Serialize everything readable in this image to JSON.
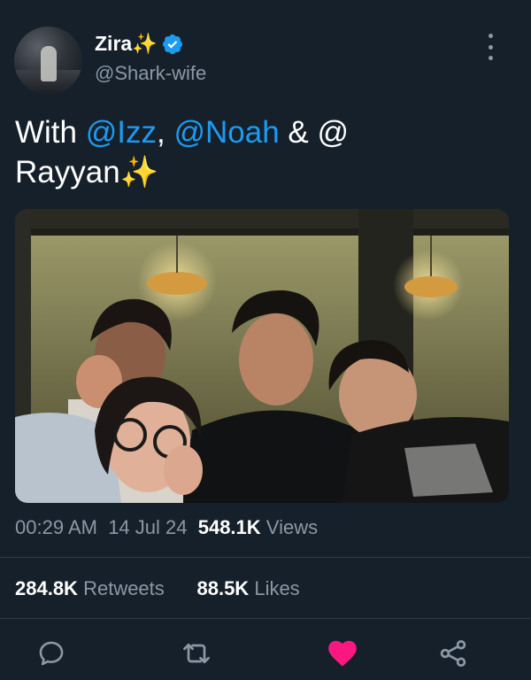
{
  "author": {
    "display_name": "Zira",
    "name_emoji": "✨",
    "handle": "@Shark-wife",
    "verified": true
  },
  "tweet": {
    "text_with": "With ",
    "mention_1": "@Izz",
    "sep_1": ", ",
    "mention_2": "@Noah",
    "sep_2": " & @",
    "line_2": "Rayyan",
    "end_emoji": "✨"
  },
  "meta": {
    "time": "00:29 AM",
    "date": "14 Jul 24",
    "views_count": "548.1K",
    "views_label": "Views"
  },
  "stats": {
    "retweets_count": "284.8K",
    "retweets_label": "Retweets",
    "likes_count": "88.5K",
    "likes_label": "Likes"
  },
  "actions": {
    "reply_icon": "reply-icon",
    "retweet_icon": "retweet-icon",
    "like_icon": "heart-filled-icon",
    "share_icon": "share-icon",
    "liked_color": "#f91880",
    "icon_color": "#8b98a5"
  },
  "colors": {
    "background": "#15202b",
    "accent": "#1d9bf0",
    "muted": "#8b98a5"
  }
}
